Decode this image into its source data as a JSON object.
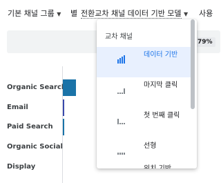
{
  "topbar": {
    "channel_group": "기본 채널 그룹",
    "by": "별",
    "cross_channel": "전환교차 채널 데이터 기반 모델",
    "usage": "사용"
  },
  "filter": {
    "percent_badge": "79%"
  },
  "rows": [
    {
      "label": "Organic Search",
      "bar_color": "#1a73a8",
      "share": 0.28
    },
    {
      "label": "Email",
      "bar_color": "#3949ab",
      "share": 0.02
    },
    {
      "label": "Paid Search",
      "bar_color": "#1a73a8",
      "share": 0.02
    },
    {
      "label": "Organic Social",
      "bar_color": "#1a73a8",
      "share": 0.0
    },
    {
      "label": "Display",
      "bar_color": "#1a73a8",
      "share": 0.0
    }
  ],
  "dropdown": {
    "header": "교차 채널",
    "items": [
      {
        "label": "데이터 기반",
        "icon": "data-driven-icon",
        "selected": true
      },
      {
        "label": "마지막 클릭",
        "icon": "last-click-icon",
        "selected": false
      },
      {
        "label": "첫 번째 클릭",
        "icon": "first-click-icon",
        "selected": false
      },
      {
        "label": "선형",
        "icon": "linear-icon",
        "selected": false
      },
      {
        "label": "위치 기반",
        "icon": "position-based-icon",
        "selected": false
      }
    ]
  },
  "colors": {
    "accent": "#1a73e8",
    "selected_bg": "#e8f0fe"
  }
}
